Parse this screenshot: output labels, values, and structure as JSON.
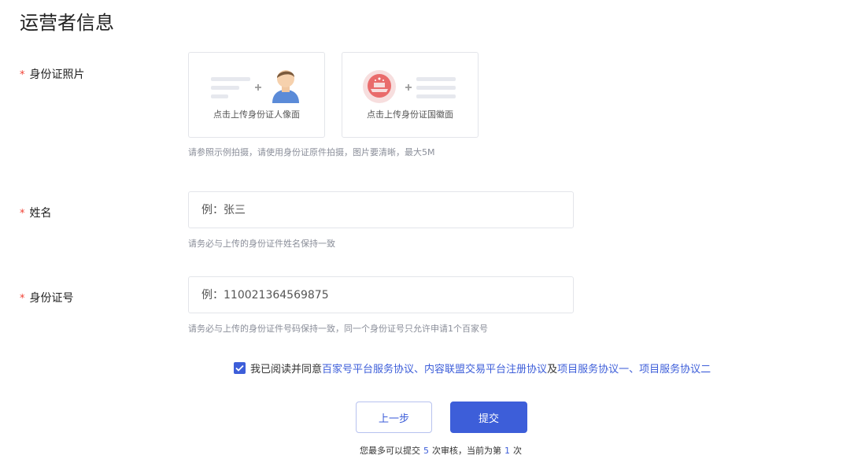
{
  "page": {
    "title": "运营者信息"
  },
  "id_photo": {
    "required_mark": "*",
    "label": "身份证照片",
    "front_caption": "点击上传身份证人像面",
    "back_caption": "点击上传身份证国徽面",
    "hint": "请参照示例拍摄，请使用身份证原件拍摄，图片要清晰，最大5M"
  },
  "name": {
    "required_mark": "*",
    "label": "姓名",
    "placeholder": "例：张三",
    "hint": "请务必与上传的身份证件姓名保持一致"
  },
  "id_number": {
    "required_mark": "*",
    "label": "身份证号",
    "placeholder": "例：110021364569875",
    "hint": "请务必与上传的身份证件号码保持一致，同一个身份证号只允许申请1个百家号"
  },
  "agreement": {
    "checked": true,
    "prefix": "我已阅读并同意",
    "link1": "百家号平台服务协议",
    "sep1": "、",
    "link2": "内容联盟交易平台注册协议",
    "sep2": "及",
    "link3": "项目服务协议一",
    "sep3": "、",
    "link4": "项目服务协议二"
  },
  "actions": {
    "prev_label": "上一步",
    "submit_label": "提交"
  },
  "submit_note": {
    "part1": "您最多可以提交",
    "max_count": "5",
    "part2": "次审核，当前为第",
    "current_count": "1",
    "part3": "次"
  },
  "colors": {
    "accent": "#3d5ed9",
    "required": "#f04134",
    "hint": "#8a8e99",
    "border": "#e3e5ea"
  }
}
